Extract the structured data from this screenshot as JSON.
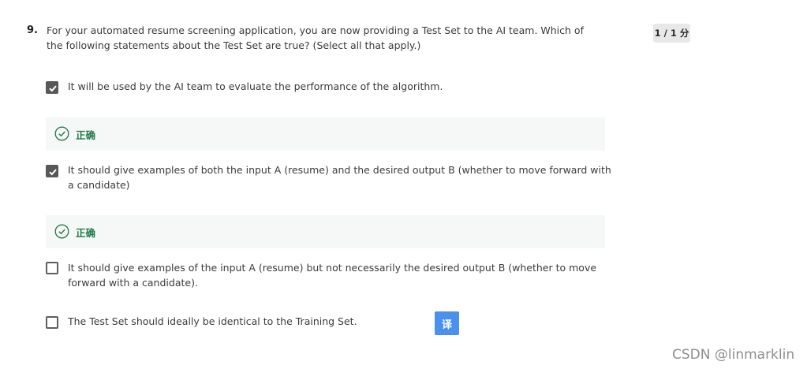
{
  "question": {
    "number": "9.",
    "text": "For your automated resume screening application, you are now providing a Test Set to the AI team. Which of the following statements about the Test Set are true? (Select all that apply.)",
    "score": "1 / 1 分"
  },
  "options": [
    {
      "label": "It will be used by the AI team to evaluate the performance of the algorithm.",
      "checked": true,
      "feedback": "正确"
    },
    {
      "label": "It should give examples of both the input A (resume) and the desired output B (whether to move forward with a candidate)",
      "checked": true,
      "feedback": "正确"
    },
    {
      "label": "It should give examples of the input A (resume) but not necessarily the desired output B (whether to move forward with a candidate).",
      "checked": false
    },
    {
      "label": "The Test Set should ideally be identical to the Training Set.",
      "checked": false
    }
  ],
  "translate_button": "译",
  "watermark": "CSDN @linmarklin",
  "colors": {
    "correct": "#1f7a48",
    "feedback_bg": "#f5f8f6",
    "checkbox": "#585858",
    "translate": "#4a90ee"
  }
}
